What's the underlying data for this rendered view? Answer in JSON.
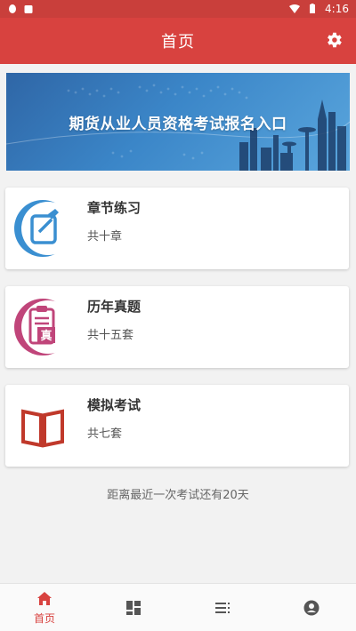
{
  "status_bar": {
    "time": "4:16"
  },
  "app_bar": {
    "title": "首页"
  },
  "banner": {
    "text": "期货从业人员资格考试报名入口"
  },
  "cards": [
    {
      "title": "章节练习",
      "subtitle": "共十章"
    },
    {
      "title": "历年真题",
      "subtitle": "共十五套",
      "icon_char": "真"
    },
    {
      "title": "模拟考试",
      "subtitle": "共七套"
    }
  ],
  "countdown": "距离最近一次考试还有20天",
  "bottom_nav": {
    "home_label": "首页"
  },
  "colors": {
    "primary": "#d8423f",
    "status_bar": "#c93f3b",
    "blue": "#3a8fd1",
    "magenta": "#c0457a",
    "book_red": "#c0392b"
  }
}
